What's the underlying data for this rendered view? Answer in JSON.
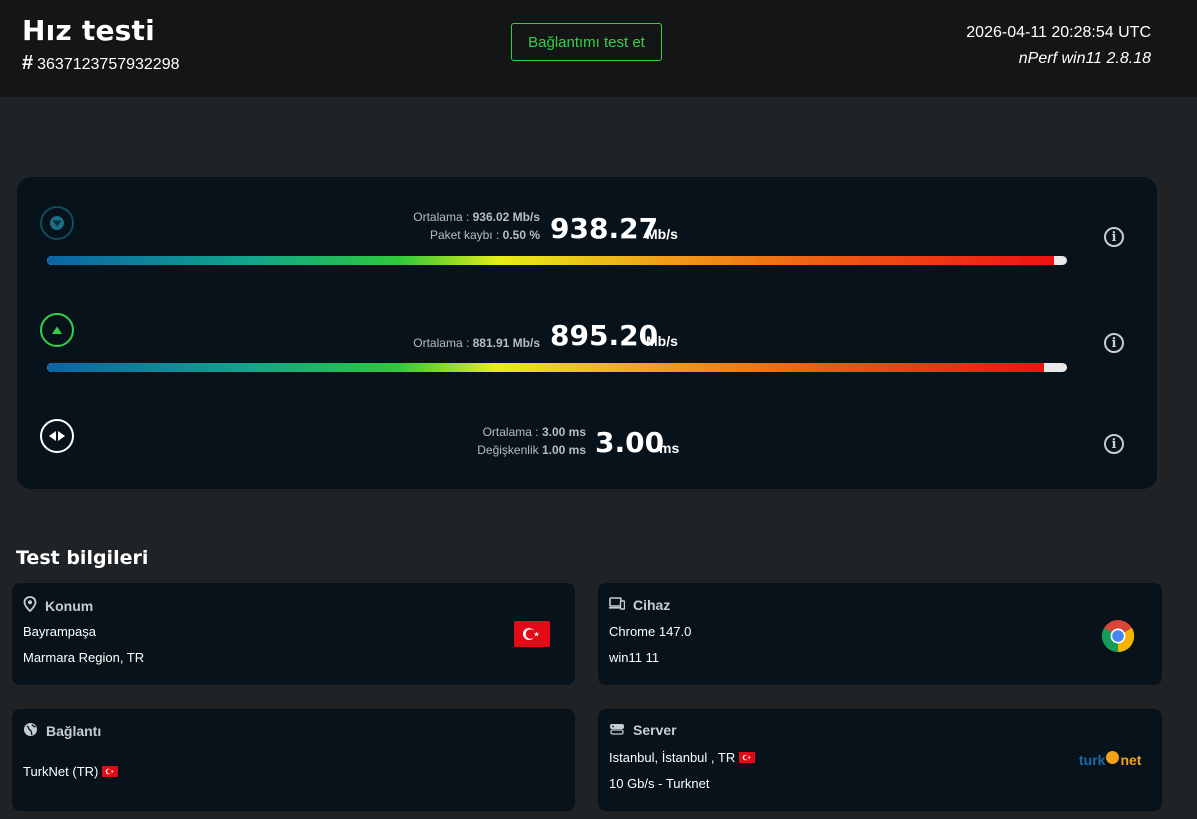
{
  "header": {
    "title": "Hız testi",
    "hash_symbol": "#",
    "test_id": "3637123757932298",
    "retest_label": "Bağlantımı test et",
    "datetime": "2026-04-11 20:28:54 UTC",
    "version": "nPerf win11 2.8.18"
  },
  "download": {
    "avg_label": "Ortalama : ",
    "avg_value": "936.02 Mb/s",
    "loss_label": "Paket kaybı : ",
    "loss_value": "0.50 %",
    "value": "938.27",
    "unit": "Mb/s",
    "fill_fraction": 0.987
  },
  "upload": {
    "avg_label": "Ortalama : ",
    "avg_value": "881.91 Mb/s",
    "value": "895.20",
    "unit": "Mb/s",
    "fill_fraction": 0.977
  },
  "latency": {
    "avg_label": "Ortalama : ",
    "avg_value": "3.00 ms",
    "jitter_label": "Değişkenlik ",
    "jitter_value": "1.00 ms",
    "value": "3.00",
    "unit": "ms"
  },
  "info_glyph": "i",
  "section_title": "Test bilgileri",
  "location": {
    "title": "Konum",
    "line1": "Bayrampaşa",
    "line2": "Marmara Region, TR"
  },
  "device": {
    "title": "Cihaz",
    "line1": "Chrome 147.0",
    "line2": "win11 11"
  },
  "connection": {
    "title": "Bağlantı",
    "line1": "TurkNet (TR)"
  },
  "server": {
    "title": "Server",
    "line1": "Istanbul, İstanbul , TR",
    "line2": "10 Gb/s - Turknet",
    "logo_text_1": "turk",
    "logo_text_2": "net"
  },
  "colors": {
    "accent_green": "#35d04a",
    "panel": "#07121a",
    "background": "#202326",
    "flag_red": "#e30a17"
  },
  "icons": [
    "download-arrow-icon",
    "upload-arrow-icon",
    "latency-icon",
    "info-icon",
    "location-pin-icon",
    "device-icon",
    "globe-icon",
    "server-icon",
    "turkey-flag-icon",
    "chrome-logo-icon"
  ]
}
